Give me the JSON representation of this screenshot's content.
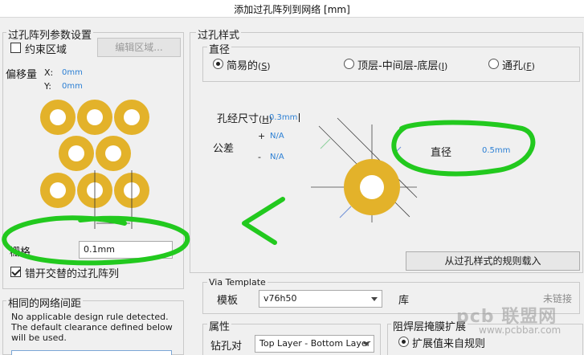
{
  "window": {
    "title": "添加过孔阵列到网络 [mm]"
  },
  "array_params": {
    "group_title": "过孔阵列参数设置",
    "constrain_label": "约束区域",
    "edit_region_button": "编辑区域...",
    "offset_label": "偏移量",
    "x_label": "X:",
    "x_value": "0mm",
    "y_label": "Y:",
    "y_value": "0mm",
    "grid_label": "栅格",
    "grid_value": "0.1mm",
    "stagger_label": "错开交替的过孔阵列",
    "stagger_checked": true
  },
  "same_net_clearance": {
    "title": "相同的网络间距",
    "message": "No applicable design rule detected. The default clearance defined below will be used."
  },
  "via_style": {
    "title": "过孔样式",
    "diameter_group": "直径",
    "options": [
      {
        "label": "简易的",
        "hotkey": "S",
        "checked": true
      },
      {
        "label": "顶层-中间层-底层",
        "hotkey": "I",
        "checked": false
      },
      {
        "label": "通孔",
        "hotkey": "F",
        "checked": false
      }
    ],
    "hole_size_label": "孔经尺寸",
    "hole_size_hotkey": "H",
    "hole_size_value": "0.3mm",
    "tolerance_label": "公差",
    "tol_plus_sign": "+",
    "tol_plus_value": "N/A",
    "tol_minus_sign": "-",
    "tol_minus_value": "N/A",
    "diameter_label": "直径",
    "diameter_value": "0.5mm",
    "load_rule_button": "从过孔样式的规则载入"
  },
  "via_template": {
    "title": "Via Template",
    "template_label": "模板",
    "template_value": "v76h50",
    "library_label": "库",
    "link_status": "未链接"
  },
  "properties": {
    "title": "属性",
    "drill_pair_label": "钻孔对",
    "drill_pair_value": "Top Layer - Bottom Layer"
  },
  "solder_mask": {
    "title": "阻焊层掩膜扩展",
    "from_rule_label": "扩展值来自规则"
  },
  "watermark": {
    "logo": "pcb 联盟网",
    "url": "www.pcbbar.com"
  },
  "colors": {
    "via_pad": "#e3b22a",
    "annotation_green": "#22c91e",
    "value_blue": "#2b7fd4"
  }
}
